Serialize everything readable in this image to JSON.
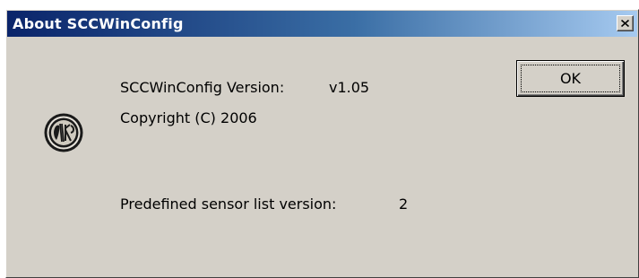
{
  "window": {
    "title": "About SCCWinConfig",
    "close_icon": "close-x-icon"
  },
  "about": {
    "logo_icon": "company-seal-logo",
    "version_label": "SCCWinConfig Version:",
    "version_value": "v1.05",
    "copyright": "Copyright (C) 2006",
    "sensor_list_label": "Predefined sensor list version:",
    "sensor_list_value": "2"
  },
  "buttons": {
    "ok_label": "OK"
  }
}
